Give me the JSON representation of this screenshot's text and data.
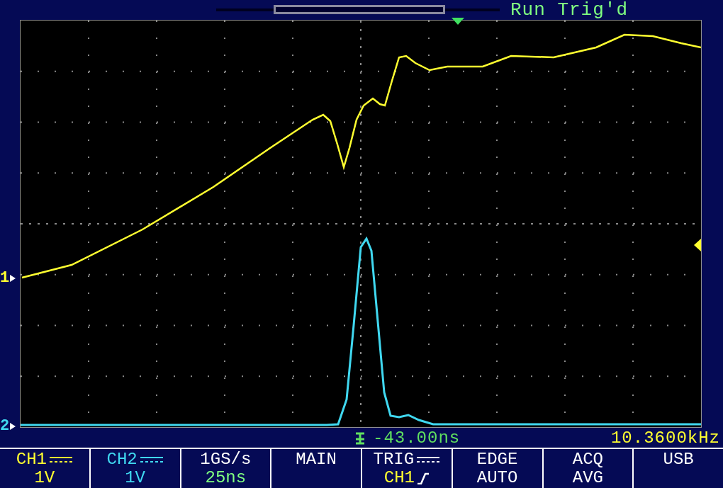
{
  "status": "Run Trig'd",
  "channel_markers": [
    {
      "label": "1",
      "color": "#ffff30"
    },
    {
      "label": "2",
      "color": "#40d8f0"
    }
  ],
  "time_offset": "-43.00ns",
  "frequency": "10.3600kHz",
  "menu": [
    {
      "kind": "channel",
      "label": {
        "text": "CH1",
        "color": "#ffff30"
      },
      "value": {
        "text": "1V",
        "color": "#ffff30"
      }
    },
    {
      "kind": "channel",
      "label": {
        "text": "CH2",
        "color": "#40d8f0"
      },
      "value": {
        "text": "1V",
        "color": "#40d8f0"
      }
    },
    {
      "label": {
        "text": "1GS/s",
        "color": "#ffffff"
      },
      "value": {
        "text": "25ns",
        "color": "#80ff80"
      }
    },
    {
      "label": {
        "text": "MAIN",
        "color": "#ffffff"
      }
    },
    {
      "kind": "trigger",
      "label": {
        "text": "TRIG",
        "color": "#ffffff"
      },
      "value": {
        "text": "CH1",
        "color": "#ffff30"
      }
    },
    {
      "label": {
        "text": "EDGE",
        "color": "#ffffff"
      },
      "value": {
        "text": "AUTO",
        "color": "#ffffff"
      }
    },
    {
      "label": {
        "text": "ACQ",
        "color": "#ffffff"
      },
      "value": {
        "text": "AVG",
        "color": "#ffffff"
      }
    },
    {
      "label": {
        "text": "USB",
        "color": "#ffffff"
      }
    }
  ]
}
